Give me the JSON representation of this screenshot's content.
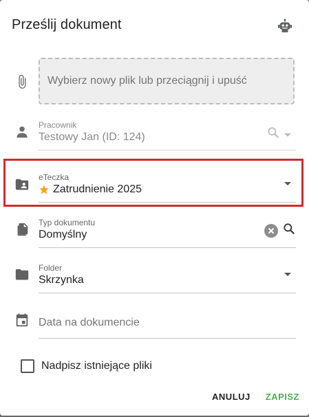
{
  "dialog": {
    "title": "Prześlij dokument",
    "robot_icon": "robot-icon"
  },
  "upload": {
    "icon": "paperclip-icon",
    "dropzone_text": "Wybierz nowy plik lub przeciągnij i upuść"
  },
  "employee": {
    "icon": "person-icon",
    "label": "Pracownik",
    "value": "Testowy Jan (ID: 124)"
  },
  "eteczka": {
    "icon": "folder-account-icon",
    "label": "eTeczka",
    "value": "Zatrudnienie 2025",
    "star_icon": "star-icon",
    "star_color": "#f5a623"
  },
  "doc_type": {
    "icon": "document-icon",
    "label": "Typ dokumentu",
    "value": "Domyślny"
  },
  "folder": {
    "icon": "folder-icon",
    "label": "Folder",
    "value": "Skrzynka"
  },
  "doc_date": {
    "icon": "calendar-icon",
    "placeholder": "Data na dokumencie"
  },
  "overwrite": {
    "label": "Nadpisz istniejące pliki",
    "checked": false
  },
  "buttons": {
    "cancel": "ANULUJ",
    "save": "ZAPISZ"
  },
  "colors": {
    "highlight": "#d42a2a",
    "save": "#4caf50"
  }
}
